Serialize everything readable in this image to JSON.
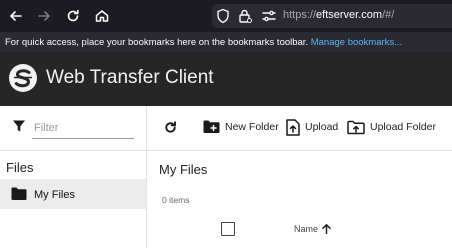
{
  "browser": {
    "url_host": "eftserver.com",
    "url_prefix": "https://",
    "url_suffix": "/#/"
  },
  "bookmarks": {
    "message": "For quick access, place your bookmarks here on the bookmarks toolbar.",
    "link": "Manage bookmarks..."
  },
  "app": {
    "title": "Web Transfer Client"
  },
  "sidebar": {
    "filter_placeholder": "Filter",
    "heading": "Files",
    "items": [
      {
        "label": "My Files",
        "icon": "folder-icon"
      }
    ]
  },
  "toolbar": {
    "refresh_icon": "refresh-icon",
    "new_folder": "New Folder",
    "upload": "Upload",
    "upload_folder": "Upload Folder"
  },
  "main": {
    "title": "My Files",
    "item_count": "0 items",
    "columns": [
      {
        "label": "Name",
        "sort": "ascending"
      }
    ]
  },
  "colors": {
    "browser_bg": "#1c1b22",
    "bookmarks_bg": "#2b2a33",
    "link": "#57b7f5",
    "app_header_bg": "#262626",
    "selected_item_bg": "#ececec"
  }
}
